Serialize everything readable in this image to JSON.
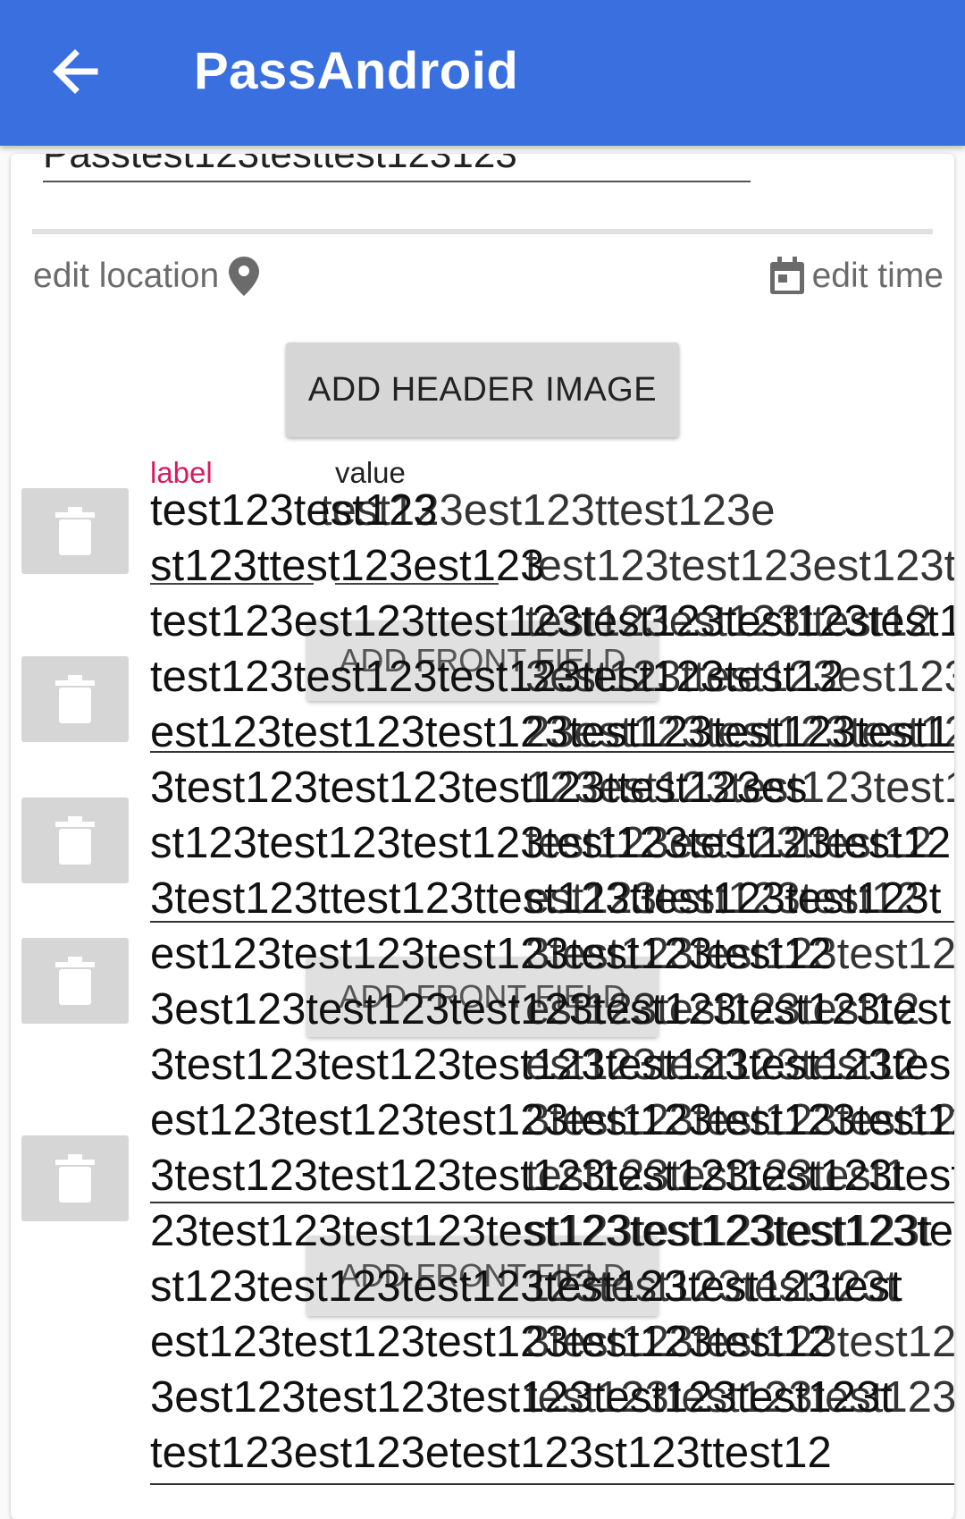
{
  "appbar": {
    "title": "PassAndroid",
    "back_icon": "arrow-back-icon",
    "color": "#3a6fe0"
  },
  "description_field": {
    "value": "Passtest123testtest123123"
  },
  "edit_location": {
    "label": "edit location",
    "icon": "location-pin-icon"
  },
  "edit_time": {
    "label": "edit time",
    "icon": "calendar-icon"
  },
  "add_header_image_button": "ADD HEADER IMAGE",
  "columns": {
    "label": "label",
    "value": "value"
  },
  "add_front_field_button": "ADD FRONT FIELD",
  "first_row": {
    "label": "test123",
    "value": "test123"
  },
  "overlapping_lines": [
    {
      "a": "test123test123",
      "b": "test123est123ttest123e"
    },
    {
      "a": "st123ttest123est123",
      "b": "test123test123est123t"
    },
    {
      "a": "test123est123ttest123test123test123test12",
      "b": "test123est123ttest12"
    },
    {
      "a": "test123test123test123test123test12",
      "b": "3est123ttest123est123t"
    },
    {
      "a": "est123test123test123test123test123test1",
      "b": "23est123test123test12"
    },
    {
      "a": "3test123test123test123ttest123es",
      "b": "123est123test123test1"
    },
    {
      "a": "st123test123test123test123test123test12",
      "b": "test123est123ttest12"
    },
    {
      "a": "3test123ttest123ttest123ttest123test123t",
      "b": "est123test123test12"
    },
    {
      "a": "est123test123test123test123test12",
      "b": "3test123test123test12"
    },
    {
      "a": "3est123test123test123test123test123test123t",
      "b": "est123test123test12"
    },
    {
      "a": "3test123test123test123test123test123tes",
      "b": "est123test123test12"
    },
    {
      "a": "est123test123test123test123test123test12",
      "b": "3test123test123test12"
    },
    {
      "a": "3test123test123test123test123test123test12",
      "b": "test123test123test1"
    },
    {
      "a": "23test123test123test123test123test123te",
      "b": "st123test123test123t"
    },
    {
      "a": "st123test123test123test123test123test",
      "b": "123test123test123t"
    },
    {
      "a": "est123test123test123test123test12",
      "b": "3test123test123test12"
    },
    {
      "a": "3est123test123test123test123test123t",
      "b": "test123test123test123"
    },
    {
      "a": "test123est123etest123st123ttest12",
      "b": ""
    }
  ]
}
